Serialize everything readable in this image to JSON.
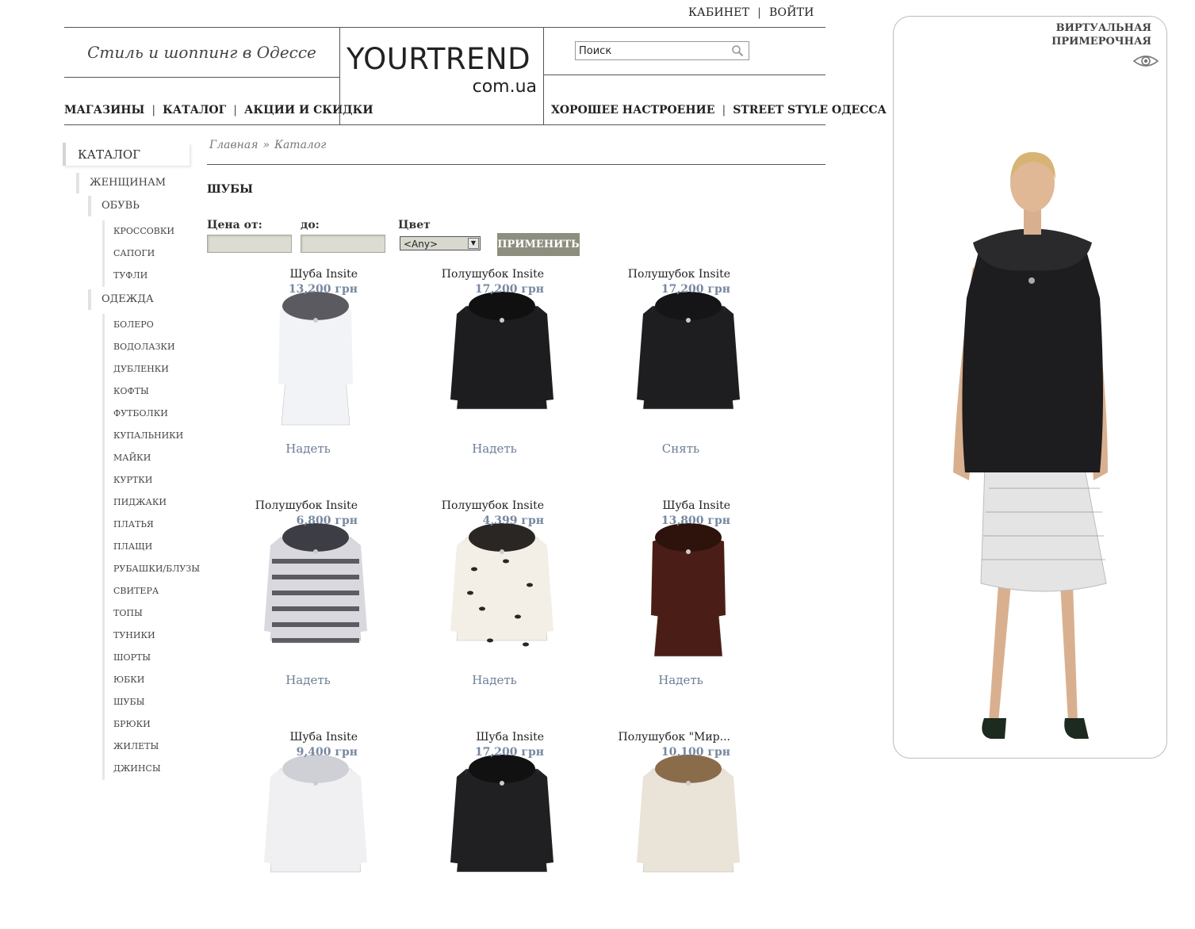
{
  "top_links": {
    "cabinet": "КАБИНЕТ",
    "login": "ВОЙТИ",
    "sep": "|"
  },
  "header": {
    "tagline": "Стиль и шоппинг в Одессе",
    "logo_main": "YOURTREND",
    "logo_sub": "com.ua",
    "nav_left": [
      "МАГАЗИНЫ",
      "КАТАЛОГ",
      "АКЦИИ И СКИДКИ"
    ],
    "nav_right": [
      "ХОРОШЕЕ НАСТРОЕНИЕ",
      "STREET STYLE ОДЕССА"
    ],
    "search": {
      "value": "Поиск"
    },
    "nav_sep": "|"
  },
  "sidebar": {
    "title": "КАТАЛОГ",
    "women": "ЖЕНЩИНАМ",
    "shoes": "ОБУВЬ",
    "shoes_items": [
      "КРОССОВКИ",
      "САПОГИ",
      "ТУФЛИ"
    ],
    "clothes": "ОДЕЖДА",
    "clothes_items": [
      "БОЛЕРО",
      "ВОДОЛАЗКИ",
      "ДУБЛЕНКИ",
      "КОФТЫ",
      "ФУТБОЛКИ",
      "КУПАЛЬНИКИ",
      "МАЙКИ",
      "КУРТКИ",
      "ПИДЖАКИ",
      "ПЛАТЬЯ",
      "ПЛАЩИ",
      "РУБАШКИ/БЛУЗЫ",
      "СВИТЕРА",
      "ТОПЫ",
      "ТУНИКИ",
      "ШОРТЫ",
      "ЮБКИ",
      "ШУБЫ",
      "БРЮКИ",
      "ЖИЛЕТЫ",
      "ДЖИНСЫ"
    ]
  },
  "breadcrumb": {
    "home": "Главная",
    "sep": "»",
    "current": "Каталог"
  },
  "page_title": "ШУБЫ",
  "filters": {
    "price_from_label": "Цена от:",
    "price_to_label": "до:",
    "color_label": "Цвет",
    "color_selected": "<Any>",
    "apply_label": "ПРИМЕНИТЬ"
  },
  "products": [
    {
      "name": "Шуба Insite",
      "price": "13,200 грн",
      "action": "Надеть",
      "style": "white-fox",
      "colors": {
        "body": "#f2f3f6",
        "trim": "#5a5a60"
      }
    },
    {
      "name": "Полушубок Insite",
      "price": "17,200 грн",
      "action": "Надеть",
      "style": "black-short",
      "colors": {
        "body": "#1d1c1e",
        "trim": "#101010"
      }
    },
    {
      "name": "Полушубок Insite",
      "price": "17,200 грн",
      "action": "Снять",
      "style": "black-jacket",
      "colors": {
        "body": "#1e1d20",
        "trim": "#151416"
      }
    },
    {
      "name": "Полушубок Insite",
      "price": "6,800 грн",
      "action": "Надеть",
      "style": "chinchilla",
      "colors": {
        "body": "#d8d8de",
        "trim": "#3d3d45"
      }
    },
    {
      "name": "Полушубок Insite",
      "price": "4,399 грн",
      "action": "Надеть",
      "style": "lynx",
      "colors": {
        "body": "#f4efe6",
        "trim": "#2a2624"
      }
    },
    {
      "name": "Шуба Insite",
      "price": "13,800 грн",
      "action": "Надеть",
      "style": "brown-mink",
      "colors": {
        "body": "#4a1e16",
        "trim": "#2e120c"
      }
    },
    {
      "name": "Шуба Insite",
      "price": "9,400 грн",
      "action": "",
      "style": "white-mink",
      "colors": {
        "body": "#f0f0f2",
        "trim": "#cfcfd6"
      }
    },
    {
      "name": "Шуба Insite",
      "price": "17,200 грн",
      "action": "",
      "style": "black-mink",
      "colors": {
        "body": "#202022",
        "trim": "#111"
      }
    },
    {
      "name": "Полушубок \"Мир...",
      "price": "10,100 грн",
      "action": "",
      "style": "fox",
      "colors": {
        "body": "#e9e3d8",
        "trim": "#8a6b4a"
      }
    }
  ],
  "fitting_room": {
    "title_line1": "ВИРТУАЛЬНАЯ",
    "title_line2": "ПРИМЕРОЧНАЯ",
    "icon": "eye-icon"
  },
  "colors": {
    "price": "#7788a0",
    "action": "#6b7d95",
    "button_bg": "#8e8e7e"
  }
}
